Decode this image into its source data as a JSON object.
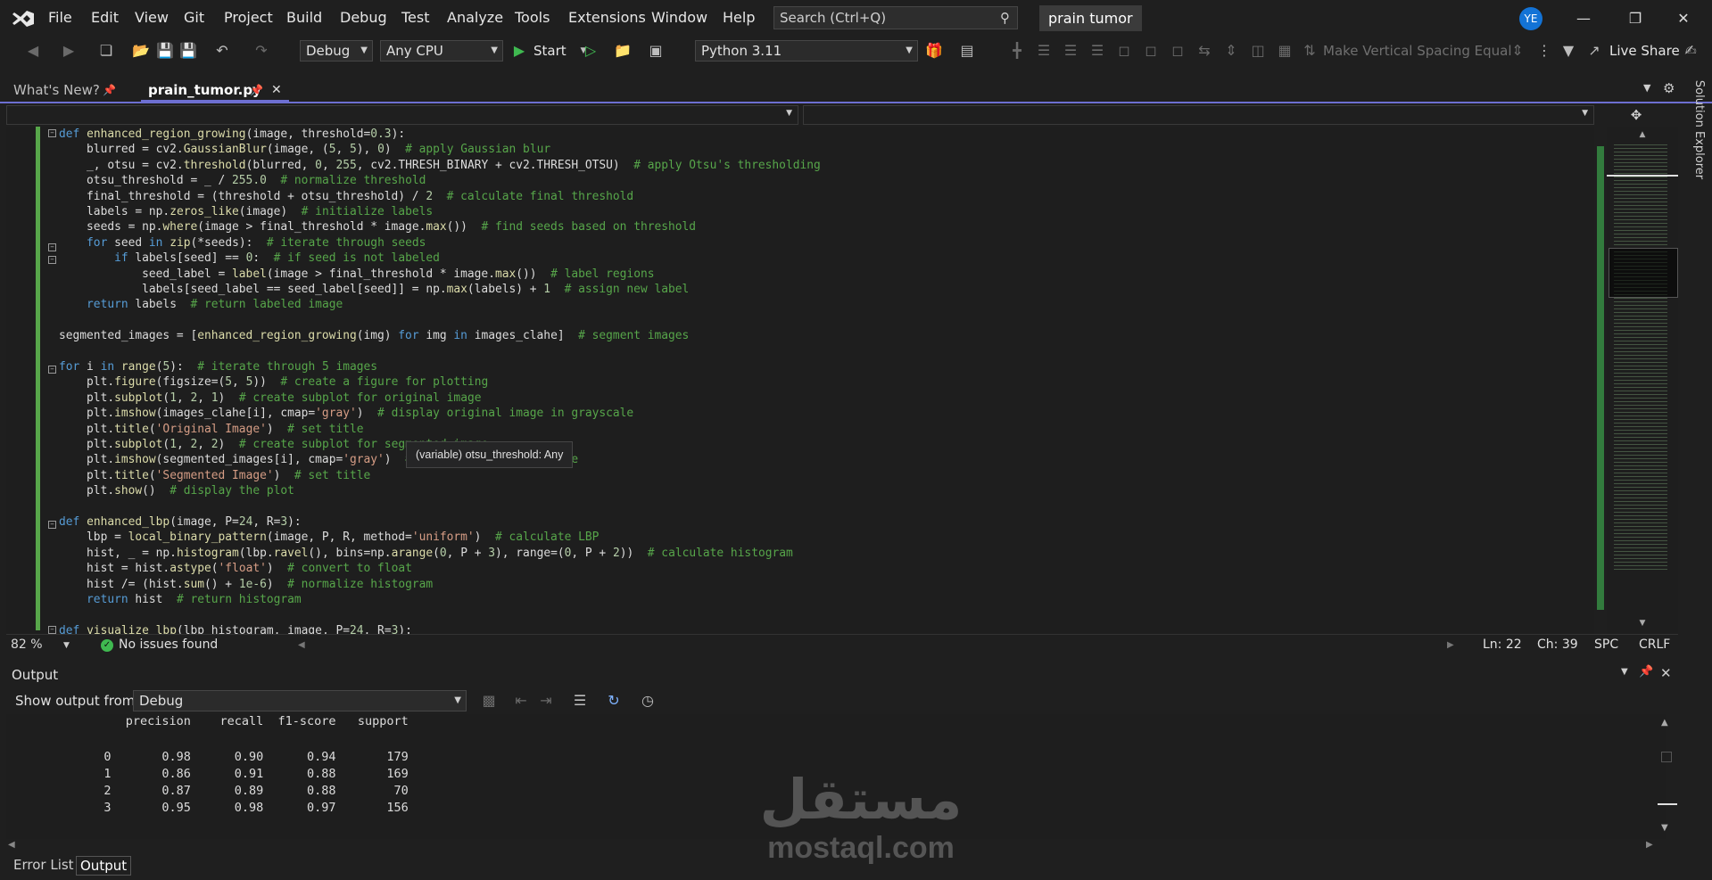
{
  "titlebar": {
    "menu": [
      "File",
      "Edit",
      "View",
      "Git",
      "Project",
      "Build",
      "Debug",
      "Test",
      "Analyze",
      "Tools",
      "Extensions",
      "Window",
      "Help"
    ],
    "search_placeholder": "Search (Ctrl+Q)",
    "solution_name": "prain tumor",
    "user_initials": "YE"
  },
  "toolbar": {
    "config": "Debug",
    "platform": "Any CPU",
    "start_label": "Start",
    "python_env": "Python 3.11",
    "spacing_label": "Make Vertical Spacing Equal",
    "live_share": "Live Share"
  },
  "tabs": [
    {
      "label": "What's New?"
    },
    {
      "label": "prain_tumor.py"
    }
  ],
  "side_panel": {
    "label": "Solution Explorer"
  },
  "tooltip": "(variable) otsu_threshold: Any",
  "status": {
    "zoom": "82 %",
    "issues": "No issues found",
    "ln": "Ln: 22",
    "ch": "Ch: 39",
    "spc": "SPC",
    "crlf": "CRLF"
  },
  "output": {
    "title": "Output",
    "show_from_label": "Show output from:",
    "source": "Debug",
    "lines": [
      "              precision    recall  f1-score   support",
      "",
      "           0       0.98      0.90      0.94       179",
      "           1       0.86      0.91      0.88       169",
      "           2       0.87      0.89      0.88        70",
      "           3       0.95      0.98      0.97       156"
    ]
  },
  "bottom_tabs": [
    "Error List",
    "Output"
  ],
  "watermark": {
    "arabic": "مستقل",
    "latin": "mostaql.com"
  }
}
